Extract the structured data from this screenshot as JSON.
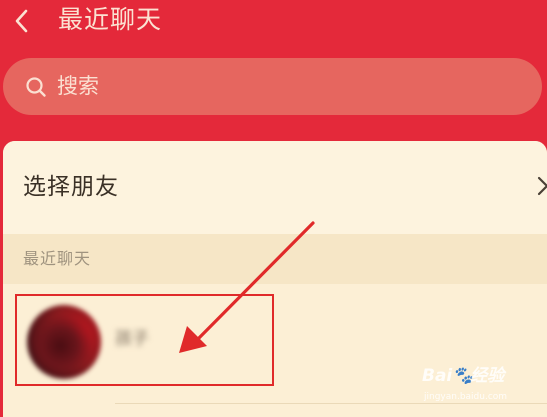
{
  "header": {
    "title": "最近聊天",
    "back_icon": "chevron-left-icon"
  },
  "search": {
    "placeholder": "搜索",
    "icon": "search-icon"
  },
  "select_friend": {
    "label": "选择朋友",
    "icon": "chevron-right-icon"
  },
  "recent_section": {
    "label": "最近聊天"
  },
  "chats": [
    {
      "name": "孩子",
      "avatar": "avatar"
    }
  ],
  "annotation": {
    "arrow_color": "#e02a2a",
    "box_color": "#e02a2a"
  },
  "watermark": {
    "brand_left": "Bai",
    "brand_right": "经验",
    "sub": "jingyan.baidu.com"
  },
  "colors": {
    "header_bg": "#e4293a",
    "search_bg": "#e6665f",
    "panel_bg": "#fcefd5",
    "section_bg": "#f6e6c6"
  }
}
